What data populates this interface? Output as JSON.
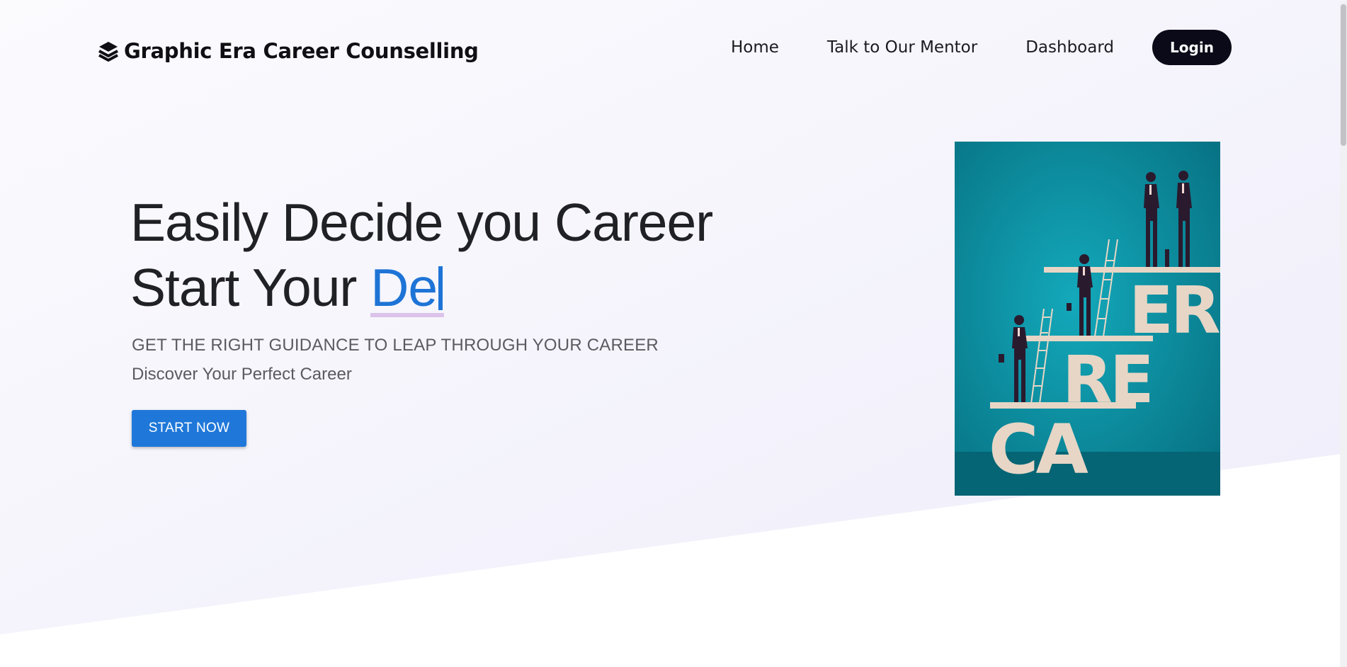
{
  "brand": {
    "name": "Graphic Era Career Counselling",
    "icon": "layers-icon"
  },
  "nav": {
    "links": [
      "Home",
      "Talk to Our Mentor",
      "Dashboard"
    ],
    "login_label": "Login"
  },
  "hero": {
    "title_line1": "Easily Decide you Career",
    "title_line2_prefix": "Start Your ",
    "typed_text": "De",
    "subtitle": "GET THE RIGHT GUIDANCE TO LEAP THROUGH YOUR CAREER",
    "tagline": "Discover Your Perfect Career",
    "cta_label": "START NOW"
  },
  "poster": {
    "letters_top": "ER",
    "letters_mid": "RE",
    "letters_bottom": "CA"
  },
  "colors": {
    "accent": "#1e74d6",
    "button_primary": "#1f78d9",
    "login_bg": "#0a0a18",
    "poster_bg": "#0a8c9e",
    "poster_letters": "#e7d6c6",
    "highlight": "#dcc3ea"
  }
}
